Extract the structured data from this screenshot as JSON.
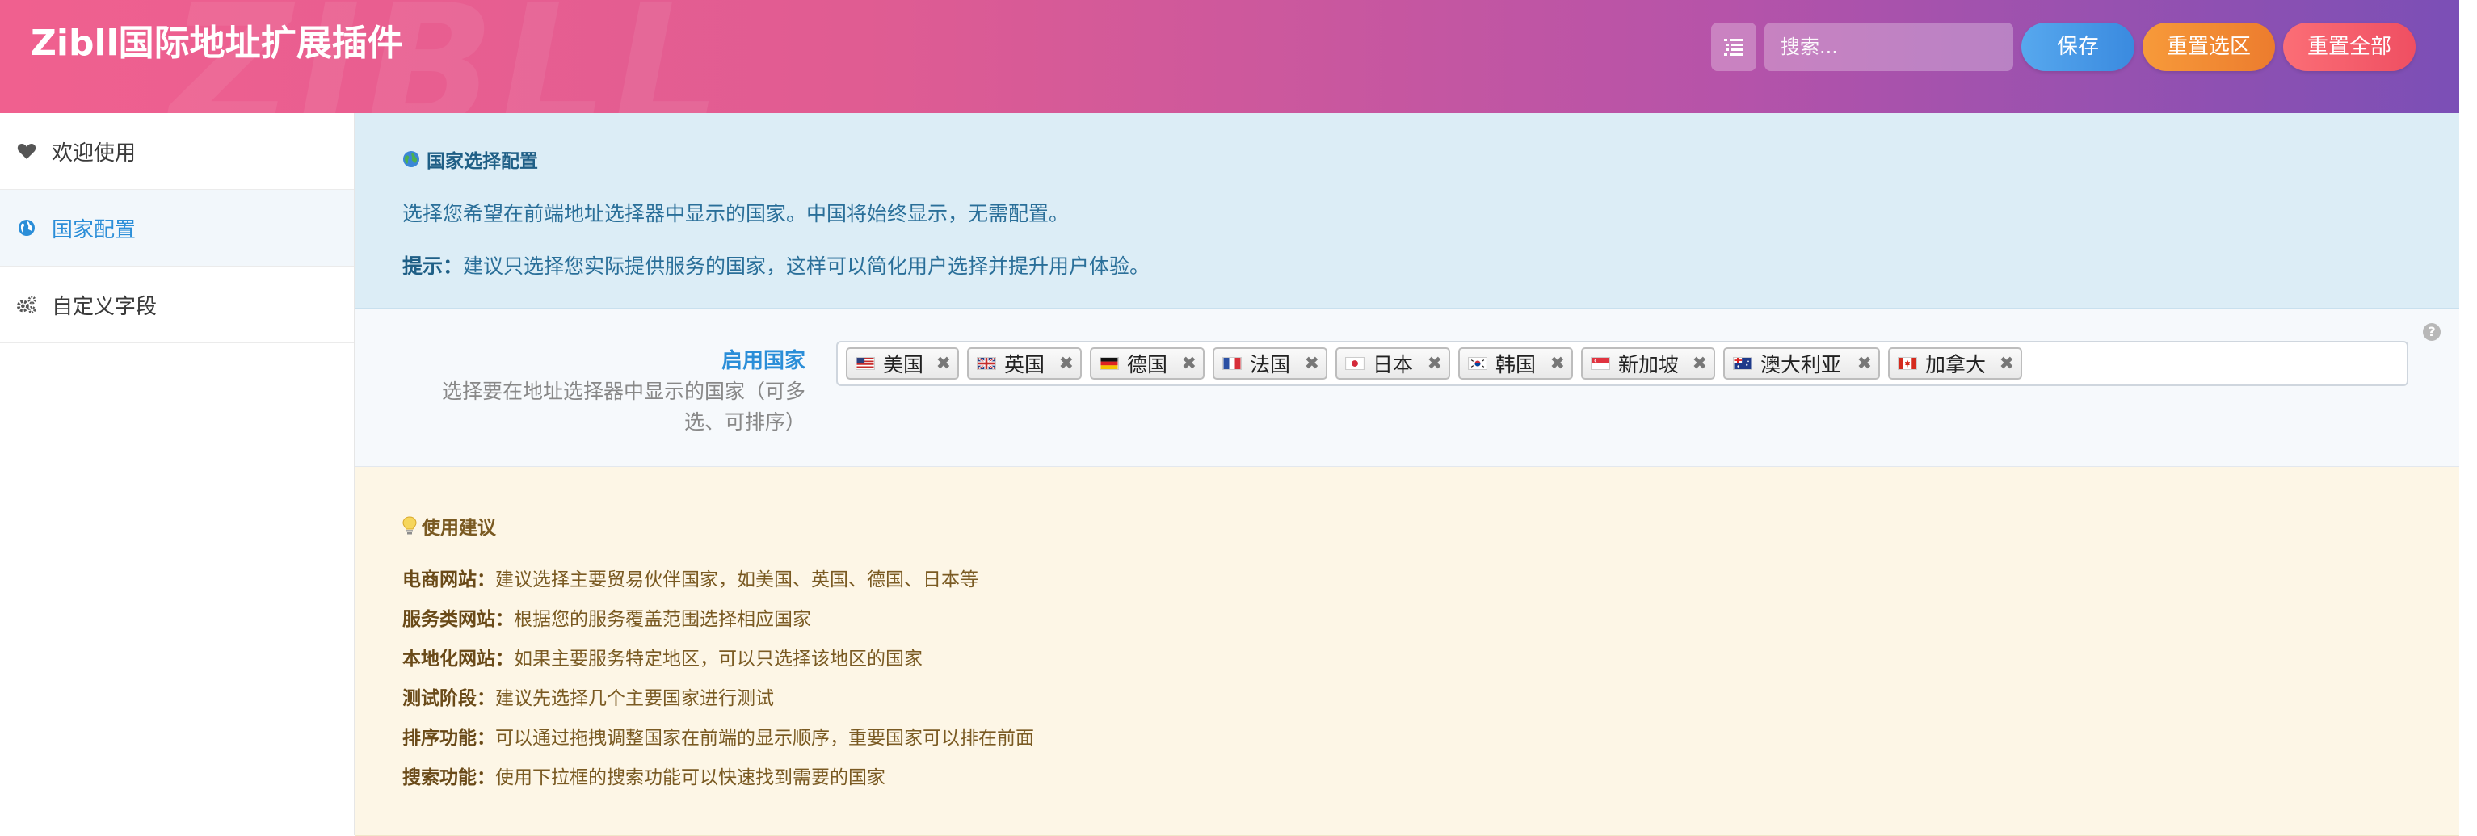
{
  "header": {
    "title": "Zibll国际地址扩展插件",
    "watermark": "ZIBLL",
    "search_placeholder": "搜索...",
    "buttons": {
      "save": "保存",
      "reset_selection": "重置选区",
      "reset_all": "重置全部"
    }
  },
  "sidebar": {
    "items": [
      {
        "label": "欢迎使用",
        "icon": "heart-icon"
      },
      {
        "label": "国家配置",
        "icon": "globe-icon",
        "active": true
      },
      {
        "label": "自定义字段",
        "icon": "cogs-icon"
      }
    ]
  },
  "notice": {
    "heading": "国家选择配置",
    "line1": "选择您希望在前端地址选择器中显示的国家。中国将始终显示，无需配置。",
    "tip_label": "提示：",
    "tip_text": "建议只选择您实际提供服务的国家，这样可以简化用户选择并提升用户体验。"
  },
  "field": {
    "label": "启用国家",
    "description": "选择要在地址选择器中显示的国家（可多选、可排序）",
    "help": "?",
    "remove_glyph": "✖",
    "tags": [
      {
        "label": "美国",
        "flag": "us"
      },
      {
        "label": "英国",
        "flag": "gb"
      },
      {
        "label": "德国",
        "flag": "de"
      },
      {
        "label": "法国",
        "flag": "fr"
      },
      {
        "label": "日本",
        "flag": "jp"
      },
      {
        "label": "韩国",
        "flag": "kr"
      },
      {
        "label": "新加坡",
        "flag": "sg"
      },
      {
        "label": "澳大利亚",
        "flag": "au"
      },
      {
        "label": "加拿大",
        "flag": "ca"
      }
    ]
  },
  "tips": {
    "heading": "使用建议",
    "items": [
      {
        "label": "电商网站：",
        "text": "建议选择主要贸易伙伴国家，如美国、英国、德国、日本等"
      },
      {
        "label": "服务类网站：",
        "text": "根据您的服务覆盖范围选择相应国家"
      },
      {
        "label": "本地化网站：",
        "text": "如果主要服务特定地区，可以只选择该地区的国家"
      },
      {
        "label": "测试阶段：",
        "text": "建议先选择几个主要国家进行测试"
      },
      {
        "label": "排序功能：",
        "text": "可以通过拖拽调整国家在前端的显示顺序，重要国家可以排在前面"
      },
      {
        "label": "搜索功能：",
        "text": "使用下拉框的搜索功能可以快速找到需要的国家"
      }
    ]
  },
  "colors": {
    "accent": "#2b8ed8",
    "header_start": "#f0608f",
    "header_end": "#7b4fb6"
  }
}
